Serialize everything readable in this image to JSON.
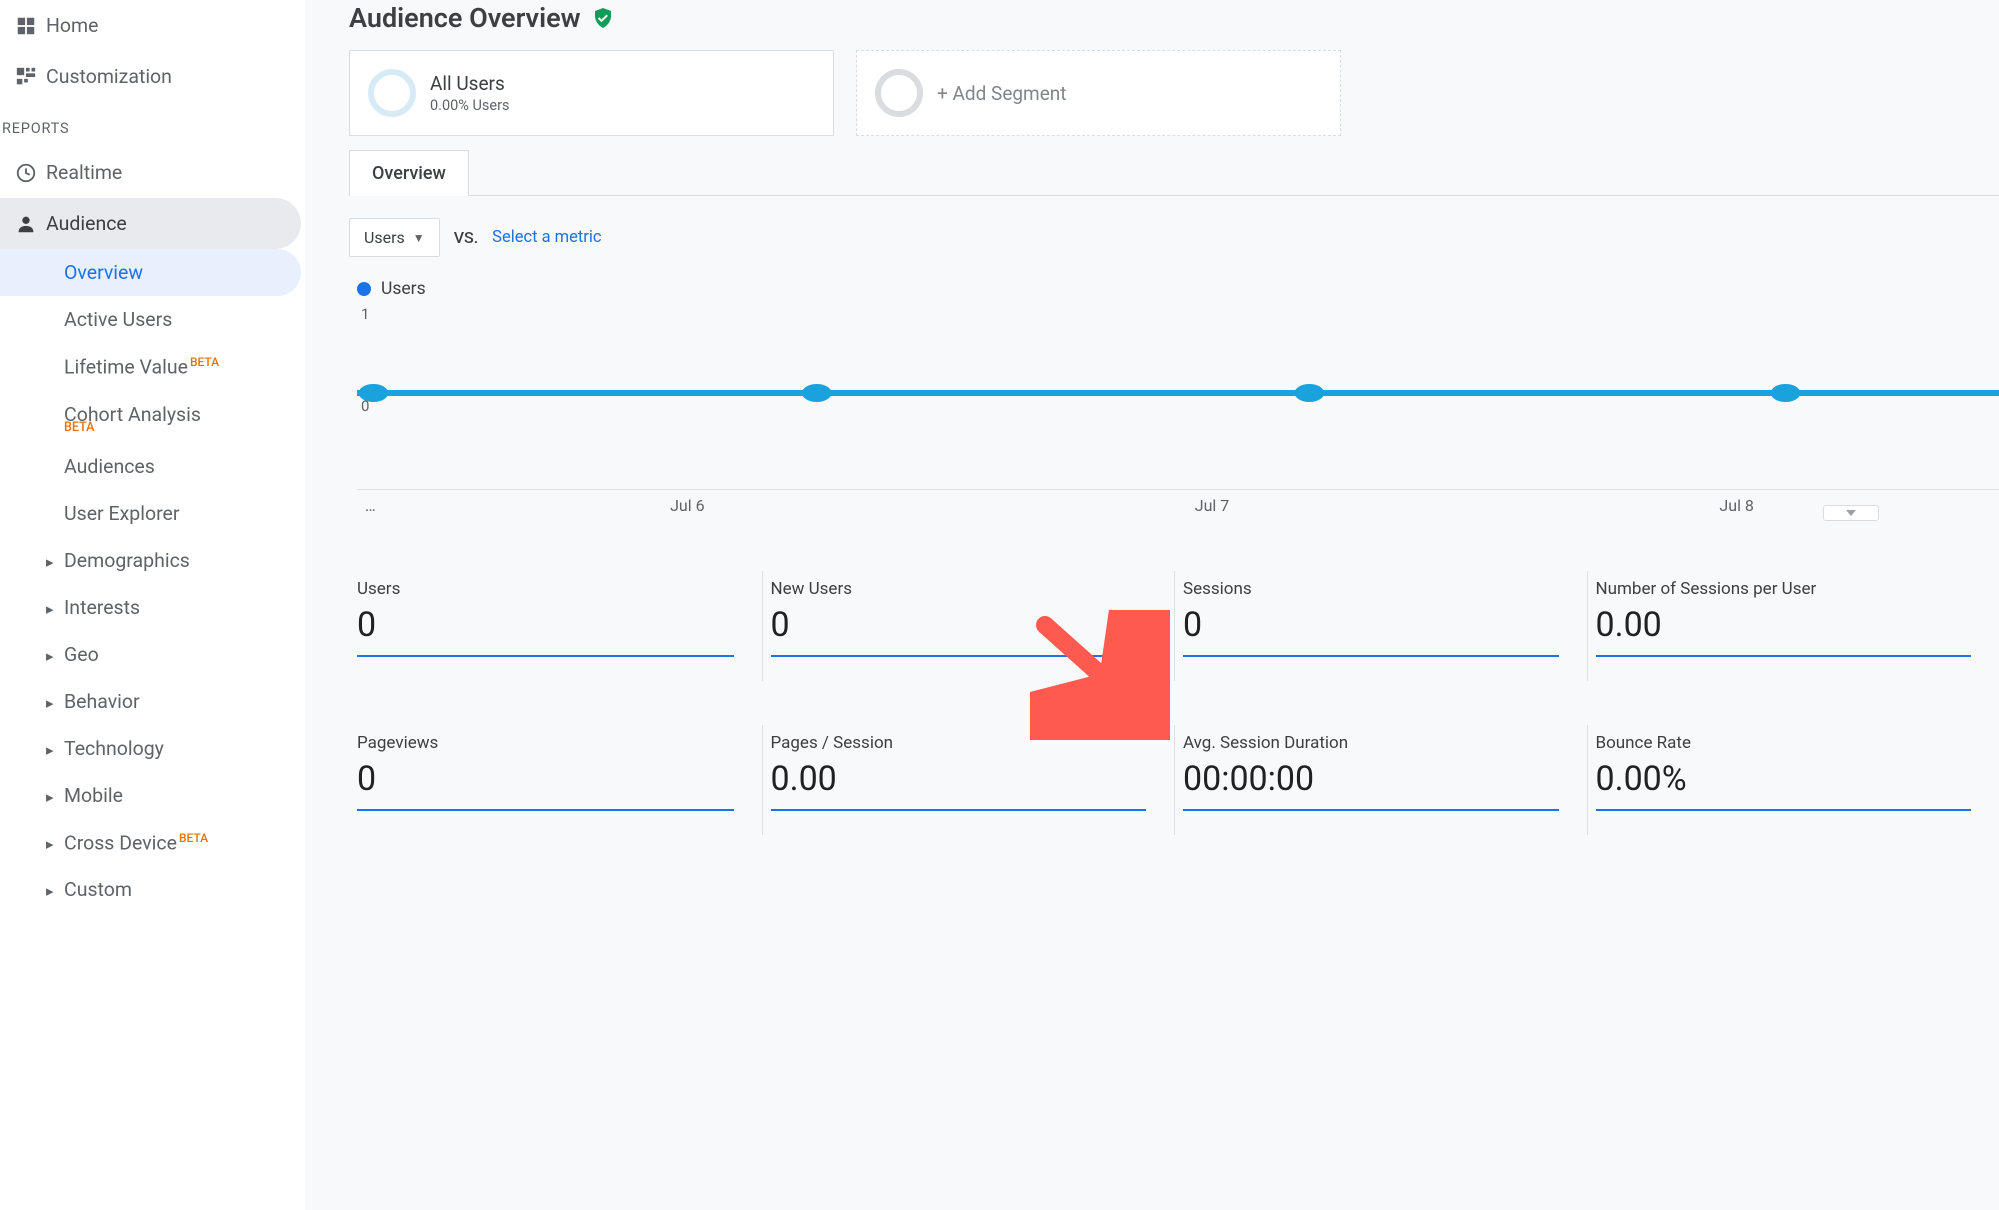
{
  "sidebar": {
    "home": "Home",
    "customization": "Customization",
    "reports_label": "REPORTS",
    "realtime": "Realtime",
    "audience": "Audience",
    "sub": {
      "overview": "Overview",
      "active_users": "Active Users",
      "lifetime_value": "Lifetime Value",
      "lifetime_value_beta": "BETA",
      "cohort_analysis": "Cohort Analysis",
      "cohort_analysis_beta": "BETA",
      "audiences": "Audiences",
      "user_explorer": "User Explorer",
      "demographics": "Demographics",
      "interests": "Interests",
      "geo": "Geo",
      "behavior": "Behavior",
      "technology": "Technology",
      "mobile": "Mobile",
      "cross_device": "Cross Device",
      "cross_device_beta": "BETA",
      "custom": "Custom"
    }
  },
  "page": {
    "title": "Audience Overview"
  },
  "segments": {
    "all_users_title": "All Users",
    "all_users_sub": "0.00% Users",
    "add_segment": "+ Add Segment"
  },
  "tabs": {
    "overview": "Overview"
  },
  "controls": {
    "metric_selected": "Users",
    "vs": "VS.",
    "select_metric": "Select a metric"
  },
  "legend": {
    "series1": "Users"
  },
  "chart_data": {
    "type": "line",
    "series": [
      {
        "name": "Users",
        "values": [
          0,
          0,
          0,
          0
        ]
      }
    ],
    "categories": [
      "…",
      "Jul 6",
      "Jul 7",
      "Jul 8"
    ],
    "ylim": [
      0,
      1
    ],
    "yticks": [
      0,
      1
    ],
    "xlabel": "",
    "ylabel": ""
  },
  "metrics": [
    {
      "label": "Users",
      "value": "0"
    },
    {
      "label": "New Users",
      "value": "0"
    },
    {
      "label": "Sessions",
      "value": "0"
    },
    {
      "label": "Number of Sessions per User",
      "value": "0.00"
    },
    {
      "label": "Pageviews",
      "value": "0"
    },
    {
      "label": "Pages / Session",
      "value": "0.00"
    },
    {
      "label": "Avg. Session Duration",
      "value": "00:00:00"
    },
    {
      "label": "Bounce Rate",
      "value": "0.00%"
    }
  ],
  "axis": {
    "y0": "0",
    "y1": "1",
    "x0": "…",
    "x1": "Jul 6",
    "x2": "Jul 7",
    "x3": "Jul 8"
  }
}
